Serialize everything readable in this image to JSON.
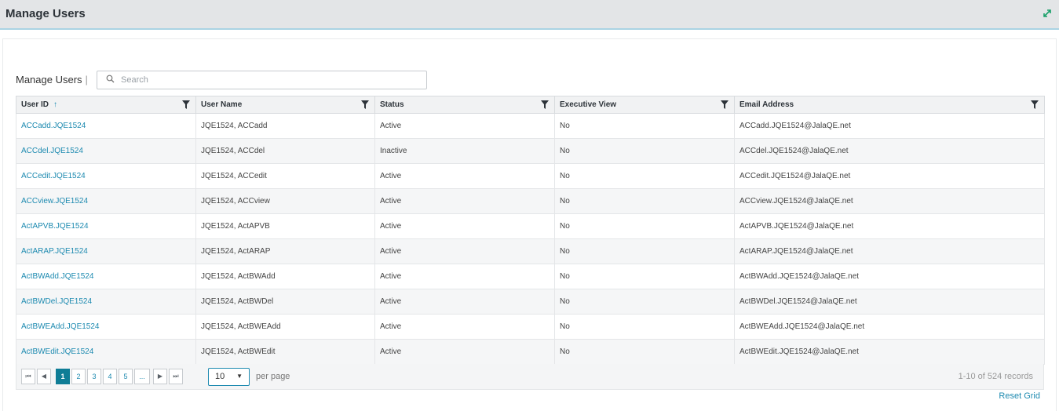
{
  "header": {
    "title": "Manage Users"
  },
  "grid": {
    "title": "Manage Users",
    "title_sep": "|",
    "search_placeholder": "Search",
    "columns": [
      "User ID",
      "User Name",
      "Status",
      "Executive View",
      "Email Address"
    ],
    "sort_indicator": "↑",
    "rows": [
      [
        "ACCadd.JQE1524",
        "JQE1524, ACCadd",
        "Active",
        "No",
        "ACCadd.JQE1524@JalaQE.net"
      ],
      [
        "ACCdel.JQE1524",
        "JQE1524, ACCdel",
        "Inactive",
        "No",
        "ACCdel.JQE1524@JalaQE.net"
      ],
      [
        "ACCedit.JQE1524",
        "JQE1524, ACCedit",
        "Active",
        "No",
        "ACCedit.JQE1524@JalaQE.net"
      ],
      [
        "ACCview.JQE1524",
        "JQE1524, ACCview",
        "Active",
        "No",
        "ACCview.JQE1524@JalaQE.net"
      ],
      [
        "ActAPVB.JQE1524",
        "JQE1524, ActAPVB",
        "Active",
        "No",
        "ActAPVB.JQE1524@JalaQE.net"
      ],
      [
        "ActARAP.JQE1524",
        "JQE1524, ActARAP",
        "Active",
        "No",
        "ActARAP.JQE1524@JalaQE.net"
      ],
      [
        "ActBWAdd.JQE1524",
        "JQE1524, ActBWAdd",
        "Active",
        "No",
        "ActBWAdd.JQE1524@JalaQE.net"
      ],
      [
        "ActBWDel.JQE1524",
        "JQE1524, ActBWDel",
        "Active",
        "No",
        "ActBWDel.JQE1524@JalaQE.net"
      ],
      [
        "ActBWEAdd.JQE1524",
        "JQE1524, ActBWEAdd",
        "Active",
        "No",
        "ActBWEAdd.JQE1524@JalaQE.net"
      ],
      [
        "ActBWEdit.JQE1524",
        "JQE1524, ActBWEdit",
        "Active",
        "No",
        "ActBWEdit.JQE1524@JalaQE.net"
      ]
    ]
  },
  "pager": {
    "first": "⏮",
    "prev": "◀",
    "next": "▶",
    "last": "⏭",
    "pages": [
      "1",
      "2",
      "3",
      "4",
      "5",
      "..."
    ],
    "current_page": "1",
    "page_size": "10",
    "per_page_label": "per page",
    "records": "1-10 of 524 records"
  },
  "reset_label": "Reset Grid",
  "colors": {
    "link": "#1d8ab0",
    "active_page": "#0f7d96",
    "expand_icon": "#1aa06a"
  },
  "icons": {
    "expand": "expand-icon",
    "search": "search-icon",
    "filter": "filter-icon"
  }
}
